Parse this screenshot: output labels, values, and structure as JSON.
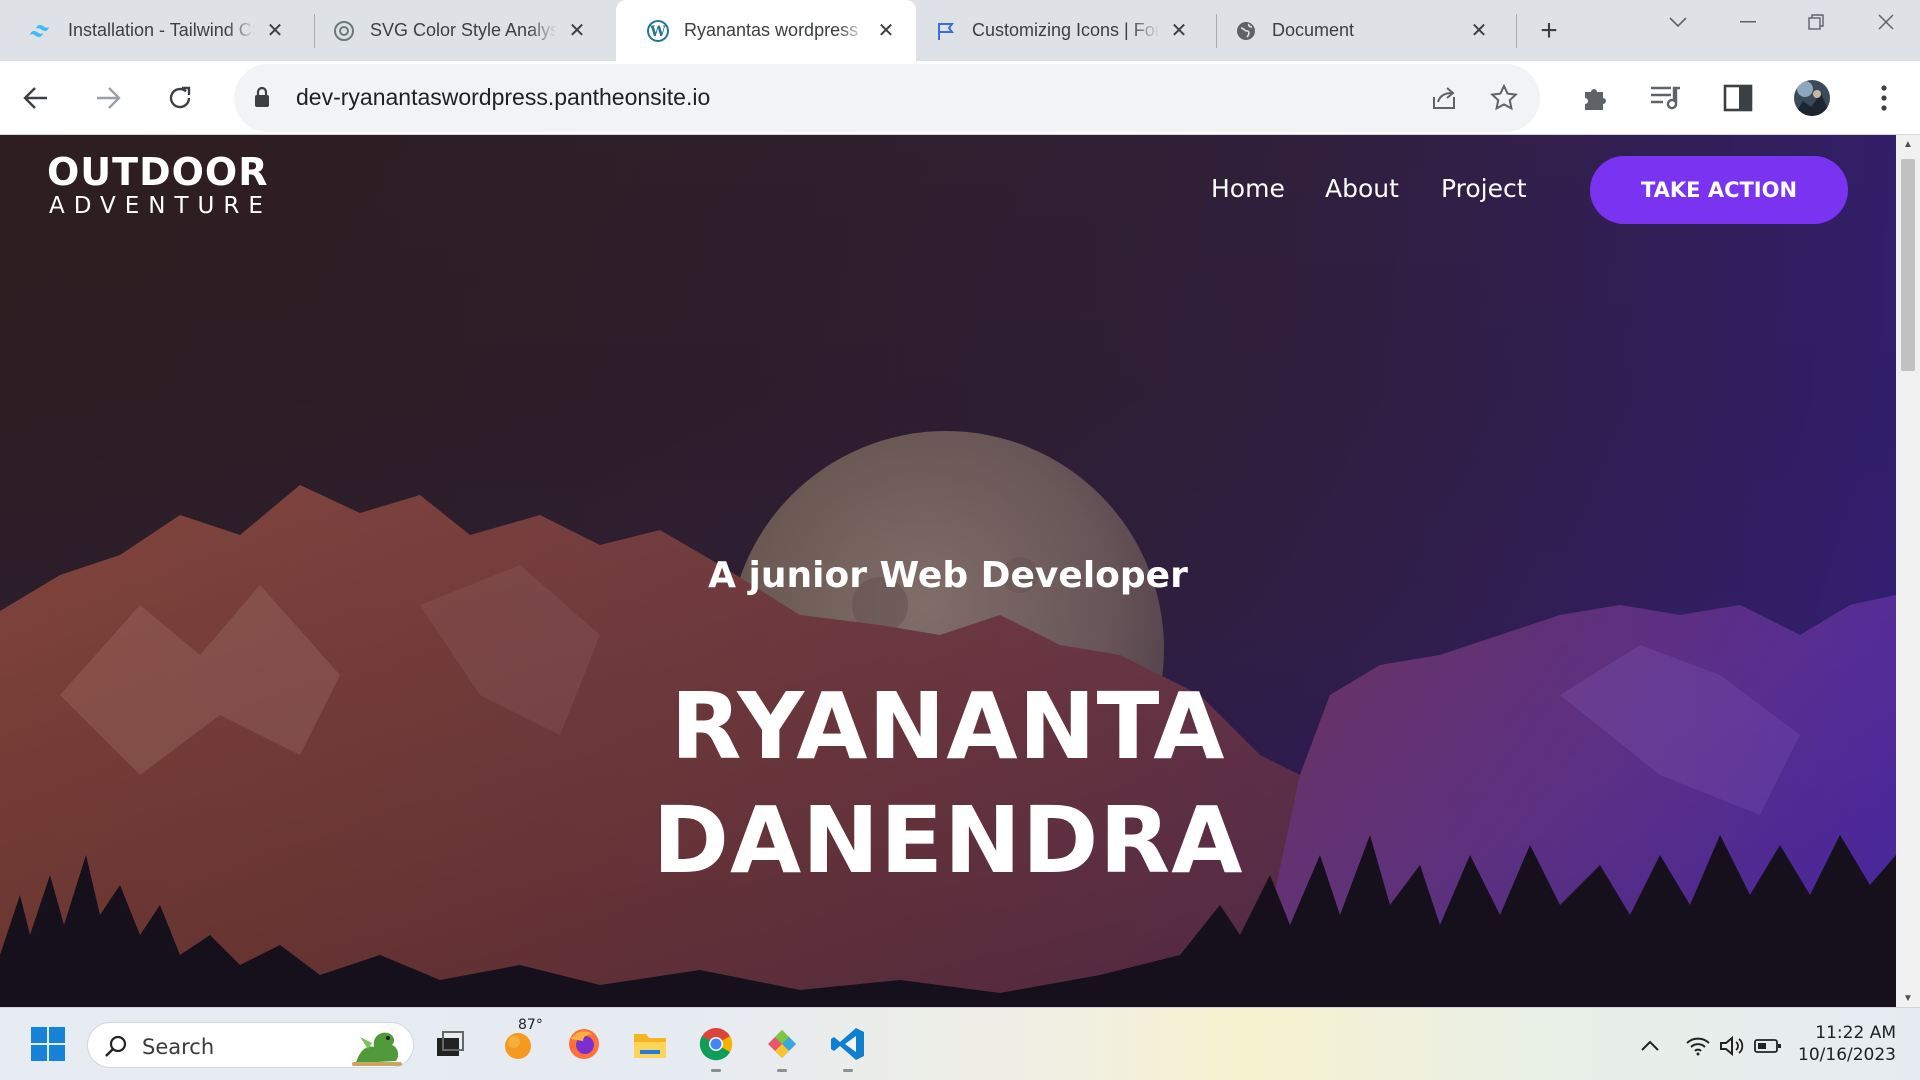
{
  "browser": {
    "tabs": [
      {
        "title": "Installation - Tailwind CSS",
        "icon": "tailwind-icon",
        "active": false
      },
      {
        "title": "SVG Color Style Analysis",
        "icon": "chatgpt-icon",
        "active": false
      },
      {
        "title": "Ryanantas wordpress",
        "icon": "wordpress-icon",
        "active": true
      },
      {
        "title": "Customizing Icons | Font Awesome",
        "icon": "flag-icon",
        "active": false
      },
      {
        "title": "Document",
        "icon": "globe-icon",
        "active": false
      }
    ],
    "url": "dev-ryanantaswordpress.pantheonsite.io"
  },
  "site": {
    "logo_line1": "OUTDOOR",
    "logo_line2": "ADVENTURE",
    "nav": [
      "Home",
      "About",
      "Project"
    ],
    "cta_label": "TAKE ACTION",
    "cta_color": "#7a33f0",
    "hero_subtitle": "A junior Web Developer",
    "hero_title_line1": "RYANANTA",
    "hero_title_line2": "DANENDRA"
  },
  "taskbar": {
    "search_label": "Search",
    "weather_temp": "87°",
    "time": "11:22 AM",
    "date": "10/16/2023"
  }
}
